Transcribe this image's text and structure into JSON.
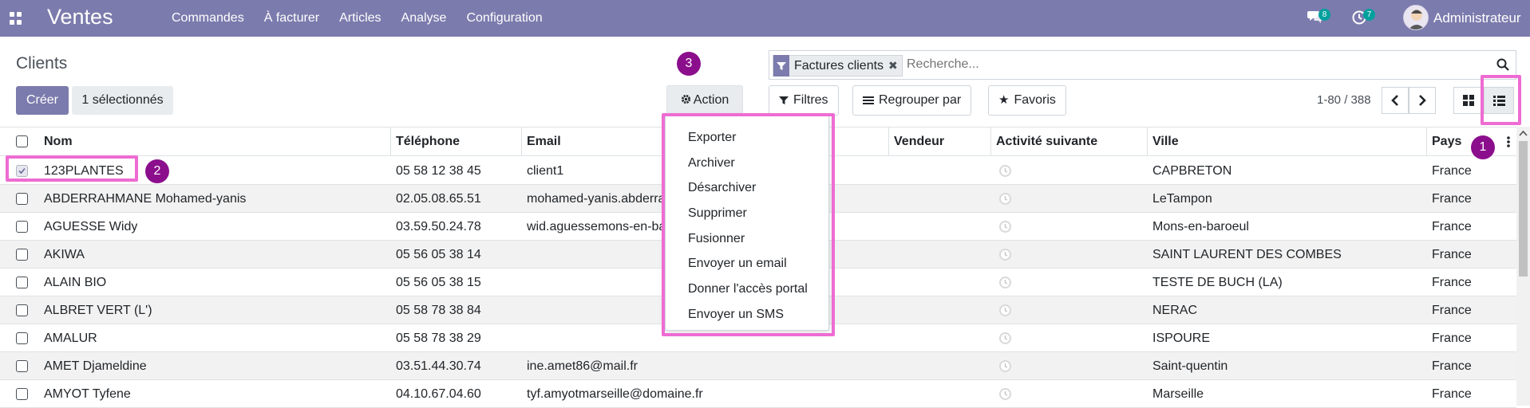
{
  "navbar": {
    "app_name": "Ventes",
    "menu": [
      "Commandes",
      "À facturer",
      "Articles",
      "Analyse",
      "Configuration"
    ],
    "messages_count": "8",
    "activities_count": "7",
    "user": "Administrateur",
    "color": "#7c7bad"
  },
  "control": {
    "title": "Clients",
    "create_label": "Créer",
    "selected_label": "1 sélectionnés",
    "action_label": "Action",
    "filters_label": "Filtres",
    "group_label": "Regrouper par",
    "favorites_label": "Favoris",
    "pager": "1-80 / 388"
  },
  "search": {
    "facet": "Factures clients",
    "placeholder": "Recherche..."
  },
  "callouts": [
    "1",
    "2",
    "3"
  ],
  "action_menu": [
    "Exporter",
    "Archiver",
    "Désarchiver",
    "Supprimer",
    "Fusionner",
    "Envoyer un email",
    "Donner l'accès portal",
    "Envoyer un SMS"
  ],
  "table": {
    "columns": [
      "Nom",
      "Téléphone",
      "Email",
      "Vendeur",
      "Activité suivante",
      "Ville",
      "Pays"
    ],
    "rows": [
      {
        "nom": "123PLANTES",
        "tel": "05 58 12 38 45",
        "email": "client1",
        "ville": "CAPBRETON",
        "pays": "France",
        "checked": true
      },
      {
        "nom": "ABDERRAHMANE Mohamed-yanis",
        "tel": "02.05.08.65.51",
        "email": "mohamed-yanis.abderra",
        "ville": "LeTampon",
        "pays": "France",
        "checked": false
      },
      {
        "nom": "AGUESSE Widy",
        "tel": "03.59.50.24.78",
        "email": "wid.aguessemons-en-ba",
        "ville": "Mons-en-baroeul",
        "pays": "France",
        "checked": false
      },
      {
        "nom": "AKIWA",
        "tel": "05 56 05 38 14",
        "email": "",
        "ville": "SAINT LAURENT DES COMBES",
        "pays": "France",
        "checked": false
      },
      {
        "nom": "ALAIN BIO",
        "tel": "05 56 05 38 15",
        "email": "",
        "ville": "TESTE DE BUCH (LA)",
        "pays": "France",
        "checked": false
      },
      {
        "nom": "ALBRET VERT (L')",
        "tel": "05 58 78 38 84",
        "email": "",
        "ville": "NERAC",
        "pays": "France",
        "checked": false
      },
      {
        "nom": "AMALUR",
        "tel": "05 58 78 38 29",
        "email": "",
        "ville": "ISPOURE",
        "pays": "France",
        "checked": false
      },
      {
        "nom": "AMET Djameldine",
        "tel": "03.51.44.30.74",
        "email": "ine.amet86@mail.fr",
        "ville": "Saint-quentin",
        "pays": "France",
        "checked": false
      },
      {
        "nom": "AMYOT Tyfene",
        "tel": "04.10.67.04.60",
        "email": "tyf.amyotmarseille@domaine.fr",
        "ville": "Marseille",
        "pays": "France",
        "checked": false
      }
    ]
  }
}
